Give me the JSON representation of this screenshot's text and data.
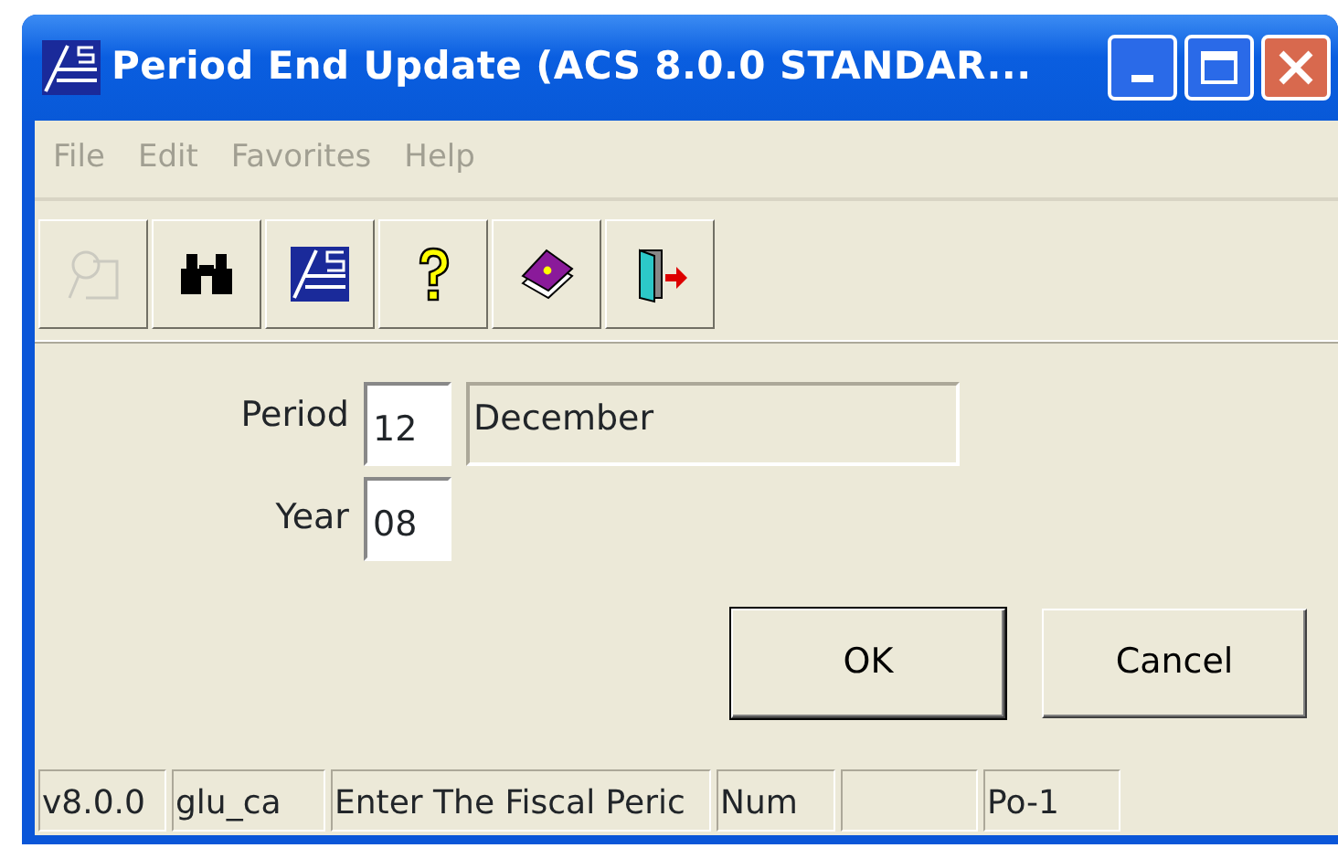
{
  "window": {
    "title": "Period End Update (ACS 8.0.0 STANDAR..."
  },
  "menu": [
    {
      "label": "File",
      "disabled": true
    },
    {
      "label": "Edit",
      "disabled": true
    },
    {
      "label": "Favorites",
      "disabled": true
    },
    {
      "label": "Help",
      "disabled": true
    }
  ],
  "toolbar": [
    {
      "kind": "find",
      "disabled": true
    },
    {
      "kind": "binoculars",
      "disabled": false
    },
    {
      "kind": "logo",
      "disabled": false
    },
    {
      "kind": "help",
      "disabled": false
    },
    {
      "kind": "book",
      "disabled": false
    },
    {
      "kind": "exit",
      "disabled": false
    }
  ],
  "form": {
    "period": {
      "label": "Period",
      "value": "12",
      "description": "December"
    },
    "year": {
      "label": "Year",
      "value": "08"
    }
  },
  "buttons": [
    {
      "label": "OK",
      "default": true
    },
    {
      "label": "Cancel",
      "default": false
    }
  ],
  "status_bar": [
    {
      "kind": "text",
      "text": "v8.0.0"
    },
    {
      "kind": "text",
      "text": "glu_ca"
    },
    {
      "kind": "text",
      "text": "Enter The Fiscal Peric"
    },
    {
      "kind": "text",
      "text": "Num"
    },
    {
      "kind": "blank"
    },
    {
      "kind": "text",
      "text": "Po-1"
    }
  ]
}
